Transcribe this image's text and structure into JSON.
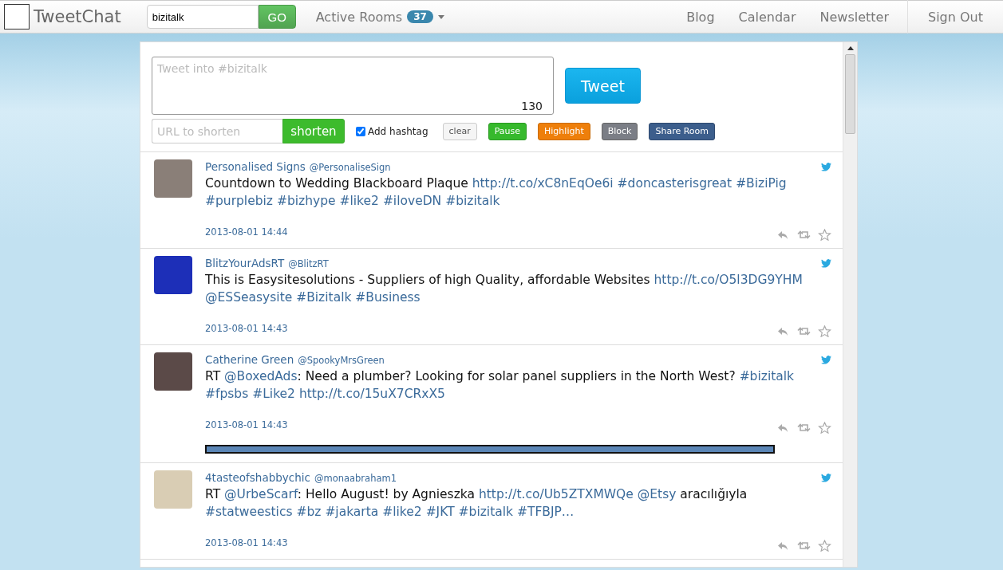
{
  "navbar": {
    "brand": "TweetChat",
    "room_field": {
      "value": "bizitalk"
    },
    "go_button": "GO",
    "active_rooms": {
      "label": "Active Rooms",
      "count": "37"
    },
    "links": [
      "Blog",
      "Calendar",
      "Newsletter"
    ],
    "sign_out": "Sign Out"
  },
  "composer": {
    "placeholder": "Tweet into #bizitalk",
    "counter": "130",
    "tweet_button": "Tweet",
    "url_field": {
      "placeholder": "URL to shorten"
    },
    "shorten_button": "shorten",
    "add_hashtag": {
      "label": "Add hashtag",
      "checked": true
    },
    "actions": [
      {
        "label": "clear",
        "kind": "plain"
      },
      {
        "label": "Pause",
        "kind": "green"
      },
      {
        "label": "Highlight",
        "kind": "orange"
      },
      {
        "label": "Block",
        "kind": "grey"
      },
      {
        "label": "Share Room",
        "kind": "navy"
      }
    ]
  },
  "tweets": [
    {
      "name": "Personalised Signs",
      "handle": "@PersonaliseSign",
      "time": "2013-08-01 14:44",
      "media": false,
      "segments": [
        {
          "kind": "text",
          "text": "Countdown to Wedding Blackboard Plaque"
        },
        {
          "kind": "link",
          "text": "http://t.co/xC8nEqOe6i"
        },
        {
          "kind": "link",
          "text": "#doncasterisgreat"
        },
        {
          "kind": "link",
          "text": "#BiziPig"
        },
        {
          "kind": "link",
          "text": "#purplebiz"
        },
        {
          "kind": "link",
          "text": "#bizhype"
        },
        {
          "kind": "link",
          "text": "#like2"
        },
        {
          "kind": "link",
          "text": "#iloveDN"
        },
        {
          "kind": "link",
          "text": "#bizitalk"
        }
      ]
    },
    {
      "name": "BlitzYourAdsRT",
      "handle": "@BlitzRT",
      "time": "2013-08-01 14:43",
      "media": false,
      "segments": [
        {
          "kind": "text",
          "text": "This is Easysitesolutions - Suppliers of high Quality, affordable Websites"
        },
        {
          "kind": "link",
          "text": "http://t.co/O5l3DG9YHM"
        },
        {
          "kind": "link",
          "text": "@ESSeasysite"
        },
        {
          "kind": "link",
          "text": "#Bizitalk"
        },
        {
          "kind": "link",
          "text": "#Business"
        }
      ]
    },
    {
      "name": "Catherine Green",
      "handle": "@SpookyMrsGreen",
      "time": "2013-08-01 14:43",
      "media": true,
      "segments": [
        {
          "kind": "text",
          "text": "RT"
        },
        {
          "kind": "link",
          "text": "@BoxedAds"
        },
        {
          "kind": "text",
          "text": ": Need a plumber? Looking for solar panel suppliers in the North West?"
        },
        {
          "kind": "link",
          "text": "#bizitalk"
        },
        {
          "kind": "link",
          "text": "#fpsbs"
        },
        {
          "kind": "link",
          "text": "#Like2"
        },
        {
          "kind": "link",
          "text": "http://t.co/15uX7CRxX5"
        }
      ]
    },
    {
      "name": "4tasteofshabbychic",
      "handle": "@monaabraham1",
      "time": "2013-08-01 14:43",
      "media": false,
      "segments": [
        {
          "kind": "text",
          "text": "RT"
        },
        {
          "kind": "link",
          "text": "@UrbeScarf"
        },
        {
          "kind": "text",
          "text": ": Hello August! by Agnieszka"
        },
        {
          "kind": "link",
          "text": "http://t.co/Ub5ZTXMWQe"
        },
        {
          "kind": "link",
          "text": "@Etsy"
        },
        {
          "kind": "text",
          "text": "aracılığıyla"
        },
        {
          "kind": "link",
          "text": "#statweestics"
        },
        {
          "kind": "link",
          "text": "#bz"
        },
        {
          "kind": "link",
          "text": "#jakarta"
        },
        {
          "kind": "link",
          "text": "#like2"
        },
        {
          "kind": "link",
          "text": "#JKT"
        },
        {
          "kind": "link",
          "text": "#bizitalk"
        },
        {
          "kind": "link",
          "text": "#TFBJP…"
        }
      ]
    }
  ]
}
